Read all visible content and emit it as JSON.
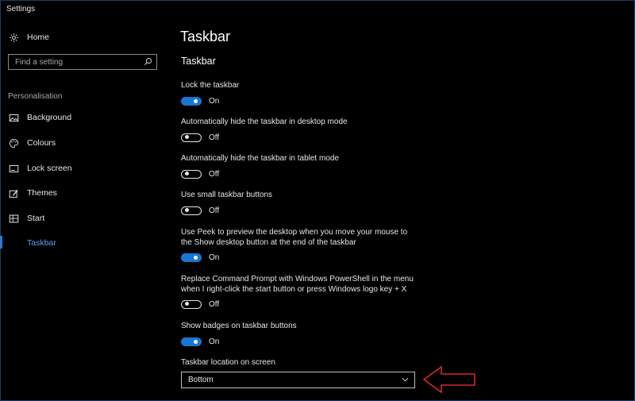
{
  "app": {
    "title": "Settings"
  },
  "sidebar": {
    "home_label": "Home",
    "search_placeholder": "Find a setting",
    "section_label": "Personalisation",
    "items": [
      {
        "label": "Background",
        "icon": "background-icon"
      },
      {
        "label": "Colours",
        "icon": "palette-icon"
      },
      {
        "label": "Lock screen",
        "icon": "lock-screen-icon"
      },
      {
        "label": "Themes",
        "icon": "themes-icon"
      },
      {
        "label": "Start",
        "icon": "start-icon"
      },
      {
        "label": "Taskbar",
        "icon": "taskbar-icon",
        "active": true
      }
    ]
  },
  "main": {
    "page_title": "Taskbar",
    "section_title": "Taskbar",
    "settings": [
      {
        "label": "Lock the taskbar",
        "state": "On"
      },
      {
        "label": "Automatically hide the taskbar in desktop mode",
        "state": "Off"
      },
      {
        "label": "Automatically hide the taskbar in tablet mode",
        "state": "Off"
      },
      {
        "label": "Use small taskbar buttons",
        "state": "Off"
      },
      {
        "label_line1": "Use Peek to preview the desktop when you move your mouse to",
        "label_line2": "the Show desktop button at the end of the taskbar",
        "state": "On"
      },
      {
        "label_line1": "Replace Command Prompt with Windows PowerShell in the menu",
        "label_line2": "when I right-click the start button or press Windows logo key + X",
        "state": "Off"
      },
      {
        "label": "Show badges on taskbar buttons",
        "state": "On"
      }
    ],
    "location": {
      "label": "Taskbar location on screen",
      "value": "Bottom"
    }
  },
  "colors": {
    "accent": "#1976d2",
    "active_nav": "#5aa0ec",
    "annotation_arrow": "#d62828",
    "background": "#000000"
  }
}
